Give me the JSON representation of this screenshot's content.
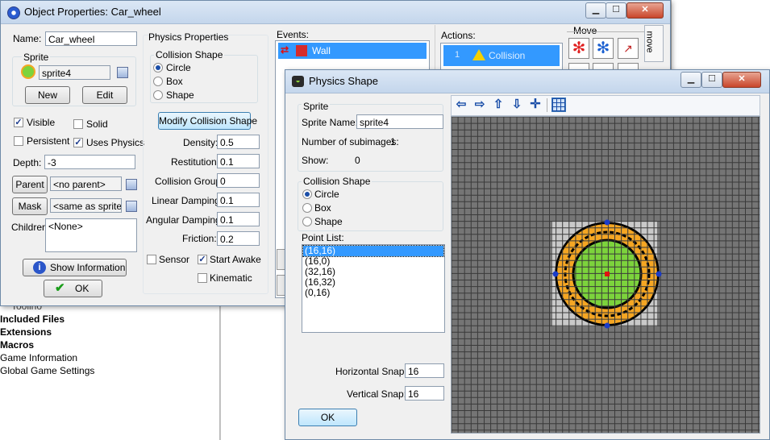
{
  "tree": {
    "items": [
      {
        "label": "Toolino",
        "bold": false
      },
      {
        "label": "Included Files",
        "bold": true
      },
      {
        "label": "Extensions",
        "bold": true
      },
      {
        "label": "Macros",
        "bold": true
      },
      {
        "label": "Game Information",
        "bold": false
      },
      {
        "label": "Global Game Settings",
        "bold": false
      }
    ]
  },
  "object_window": {
    "title": "Object Properties: Car_wheel",
    "controls": {
      "minimize": "▁",
      "maximize": "☐",
      "close": "✕"
    },
    "name_label": "Name:",
    "name_value": "Car_wheel",
    "sprite_group": "Sprite",
    "sprite_value": "sprite4",
    "new_label": "New",
    "edit_label": "Edit",
    "visible_label": "Visible",
    "solid_label": "Solid",
    "persistent_label": "Persistent",
    "uses_physics_label": "Uses Physics",
    "depth_label": "Depth:",
    "depth_value": "-3",
    "parent_label": "Parent",
    "parent_value": "<no parent>",
    "mask_label": "Mask",
    "mask_value": "<same as sprite>",
    "children_label": "Children:",
    "children_value": "<None>",
    "show_info_label": "Show Information",
    "ok_label": "OK",
    "physics": {
      "title": "Physics Properties",
      "collision_shape_label": "Collision Shape",
      "shapes": [
        "Circle",
        "Box",
        "Shape"
      ],
      "modify_label": "Modify Collision Shape",
      "density_label": "Density:",
      "density_value": "0.5",
      "restitution_label": "Restitution:",
      "restitution_value": "0.1",
      "collision_group_label": "Collision Group:",
      "collision_group_value": "0",
      "linear_damping_label": "Linear Damping:",
      "linear_damping_value": "0.1",
      "angular_damping_label": "Angular Damping:",
      "angular_damping_value": "0.1",
      "friction_label": "Friction:",
      "friction_value": "0.2",
      "sensor_label": "Sensor",
      "start_awake_label": "Start Awake",
      "kinematic_label": "Kinematic"
    },
    "events_label": "Events:",
    "event_item": "Wall",
    "actions_label": "Actions:",
    "action_item": "Collision",
    "action_index": "1",
    "move_label": "Move",
    "move_tab": "move"
  },
  "physics_window": {
    "title": "Physics Shape",
    "controls": {
      "minimize": "▁",
      "maximize": "☐",
      "close": "✕"
    },
    "sprite_group": "Sprite",
    "sprite_name_label": "Sprite Name:",
    "sprite_name_value": "sprite4",
    "subimages_label": "Number of subimages:",
    "subimages_value": "1",
    "show_label": "Show:",
    "show_value": "0",
    "collision_shape_group": "Collision Shape",
    "shapes": [
      "Circle",
      "Box",
      "Shape"
    ],
    "point_list_label": "Point List:",
    "points": [
      "(16,16)",
      "(16,0)",
      "(32,16)",
      "(16,32)",
      "(0,16)"
    ],
    "h_snap_label": "Horizontal Snap:",
    "h_snap_value": "16",
    "v_snap_label": "Vertical Snap:",
    "v_snap_value": "16",
    "ok_label": "OK",
    "toolbar": [
      "arrow-left",
      "arrow-right",
      "arrow-up",
      "arrow-down",
      "move-cross",
      "grid-toggle"
    ],
    "colors": {
      "grid_bg": "#757575",
      "outer_ring": "#f5a623",
      "inner_fill": "#7cd33c",
      "outline": "#000000",
      "vertex": "#1a3cc8",
      "center": "#e01010"
    }
  }
}
